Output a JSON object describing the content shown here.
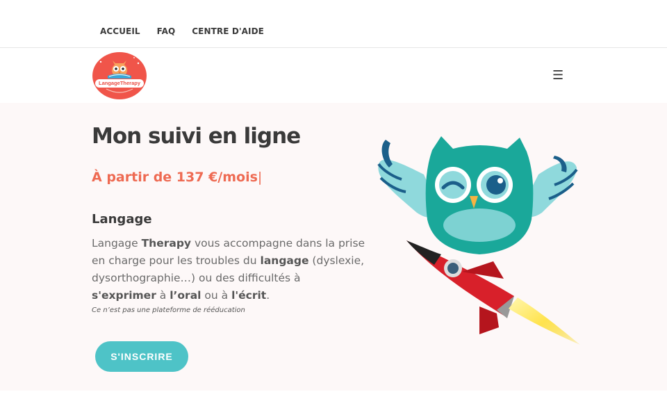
{
  "stray_char": "]",
  "top_nav": {
    "items": [
      "ACCUEIL",
      "FAQ",
      "CENTRE D'AIDE"
    ]
  },
  "header": {
    "logo_text": "LangageTherapy",
    "menu_icon": "☰"
  },
  "hero": {
    "title": "Mon suivi en ligne",
    "price": "À partir de 137 €/mois",
    "price_cursor": "|",
    "subtitle": "Langage",
    "desc": {
      "t1": "Langage ",
      "b1": "Therapy",
      "t2": " vous accompagne dans la prise en charge pour les troubles du ",
      "b2": "langage",
      "t3": " (dyslexie, dysorthographie…) ou des difficultés à ",
      "b3": "s'exprimer",
      "t4": " à ",
      "b4": "l’oral",
      "t5": " ou à ",
      "b5": "l'écrit",
      "t6": "."
    },
    "note": "Ce n’est pas une plateforme de rééducation",
    "cta_label": "S'INSCRIRE"
  },
  "colors": {
    "accent": "#ee6a52",
    "cta": "#4ec3c7",
    "owl": "#1aa89a",
    "rocket": "#d8202a"
  },
  "icons": [
    "hamburger-menu-icon",
    "owl-rocket-illustration",
    "logo-owl-icon"
  ]
}
